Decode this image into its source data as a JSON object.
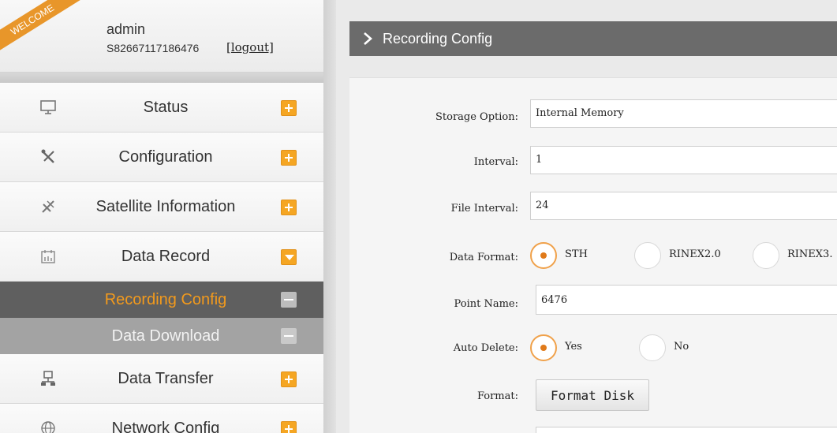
{
  "user": {
    "welcome": "WELCOME",
    "name": "admin",
    "serial": "S82667117186476",
    "logout": "[logout]"
  },
  "menu": {
    "items": [
      {
        "label": "Status",
        "icon": "monitor-icon",
        "state": "collapsed"
      },
      {
        "label": "Configuration",
        "icon": "tools-icon",
        "state": "collapsed"
      },
      {
        "label": "Satellite Information",
        "icon": "satellite-icon",
        "state": "collapsed"
      },
      {
        "label": "Data Record",
        "icon": "calendar-icon",
        "state": "expanded"
      },
      {
        "label": "Data Transfer",
        "icon": "network-icon",
        "state": "collapsed"
      },
      {
        "label": "Network Config",
        "icon": "globe-icon",
        "state": "collapsed"
      }
    ],
    "subitems": [
      {
        "label": "Recording Config",
        "active": true
      },
      {
        "label": "Data Download",
        "active": false
      }
    ]
  },
  "page": {
    "title": "Recording Config"
  },
  "form": {
    "storage_option_label": "Storage Option:",
    "storage_option_value": "Internal Memory",
    "interval_label": "Interval:",
    "interval_value": "1",
    "file_interval_label": "File Interval:",
    "file_interval_value": "24",
    "data_format_label": "Data Format:",
    "data_format_options": [
      "STH",
      "RINEX2.0",
      "RINEX3."
    ],
    "data_format_selected": "STH",
    "point_name_label": "Point Name:",
    "point_name_value": "6476",
    "auto_delete_label": "Auto Delete:",
    "auto_delete_options": [
      "Yes",
      "No"
    ],
    "auto_delete_selected": "Yes",
    "format_label": "Format:",
    "format_button": "Format Disk"
  },
  "colors": {
    "accent_orange": "#f5a623",
    "active_sub_text": "#f29a1d",
    "title_bar": "#6b6b6b"
  }
}
